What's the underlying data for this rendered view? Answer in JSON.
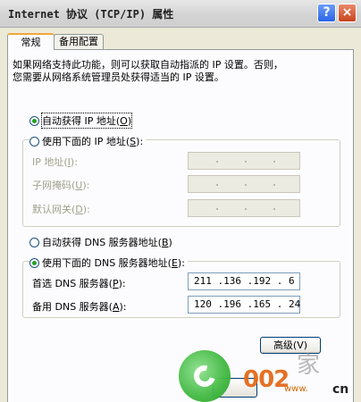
{
  "window": {
    "title": "Internet 协议 (TCP/IP) 属性",
    "help_btn": "?",
    "close_btn": "×"
  },
  "tabs": [
    {
      "label": "常规",
      "active": true
    },
    {
      "label": "备用配置",
      "active": false
    }
  ],
  "description": [
    "如果网络支持此功能，则可以获取自动指派的 IP 设置。否则，",
    "您需要从网络系统管理员处获得适当的 IP 设置。"
  ],
  "ip": {
    "auto": {
      "text": "自动获得 IP 地址(",
      "key": "O",
      "tail": ")",
      "selected": true
    },
    "manual": {
      "text": "使用下面的 IP 地址(",
      "key": "S",
      "tail": "):",
      "selected": false
    },
    "fields": [
      {
        "text": "IP 地址(",
        "key": "I",
        "tail": "):"
      },
      {
        "text": "子网掩码(",
        "key": "U",
        "tail": "):"
      },
      {
        "text": "默认网关(",
        "key": "D",
        "tail": "):"
      }
    ]
  },
  "dns": {
    "auto": {
      "text": "自动获得 DNS 服务器地址(",
      "key": "B",
      "tail": ")",
      "selected": false
    },
    "manual": {
      "text": "使用下面的 DNS 服务器地址(",
      "key": "E",
      "tail": "):",
      "selected": true
    },
    "preferred": {
      "text": "首选 DNS 服务器(",
      "key": "P",
      "tail": "):",
      "value": "211 .136 .192 . 6"
    },
    "alternate": {
      "text": "备用 DNS 服务器(",
      "key": "A",
      "tail": "):",
      "value": "120 .196 .165 . 24"
    }
  },
  "buttons": {
    "advanced": "高级(V)"
  },
  "watermark": {
    "brand": "002",
    "jia": "家",
    "url": "www.",
    "cn": "cn"
  },
  "colors": {
    "titlebar": "#d4d4d4",
    "panel": "#fcfcfe",
    "accent_tab": "#f0a63c",
    "radio_dot": "#21a121"
  }
}
